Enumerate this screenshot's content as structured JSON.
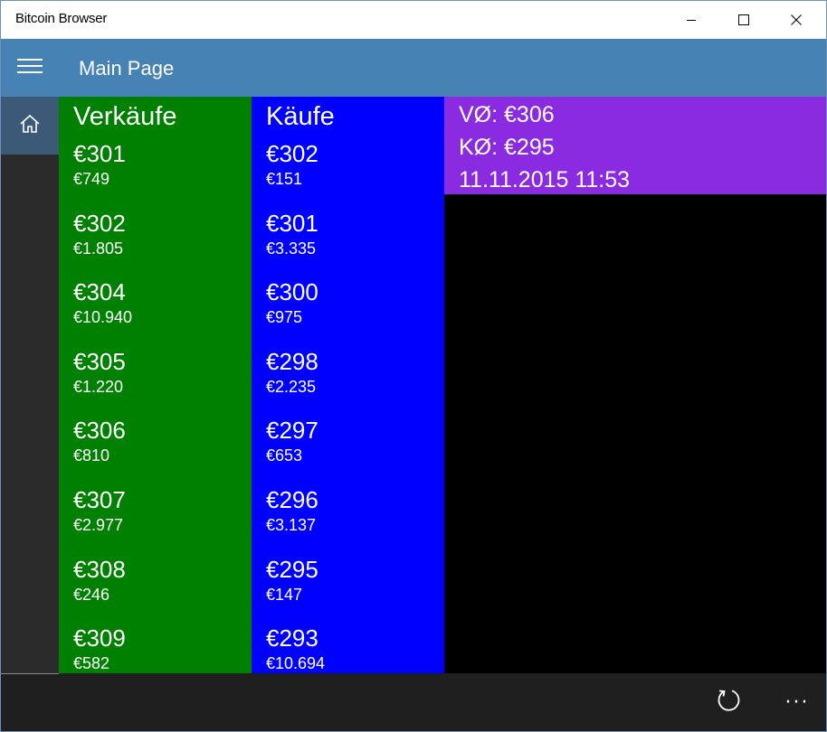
{
  "window": {
    "title": "Bitcoin Browser",
    "controls": {
      "minimize_icon": "minimize-icon",
      "maximize_icon": "maximize-icon",
      "close_icon": "close-icon"
    }
  },
  "appbar": {
    "title": "Main Page",
    "menu_icon": "hamburger-icon"
  },
  "nav": {
    "home_icon": "home-icon"
  },
  "sales": {
    "header": "Verkäufe",
    "items": [
      {
        "price": "€301",
        "amount": "€749"
      },
      {
        "price": "€302",
        "amount": "€1.805"
      },
      {
        "price": "€304",
        "amount": "€10.940"
      },
      {
        "price": "€305",
        "amount": "€1.220"
      },
      {
        "price": "€306",
        "amount": "€810"
      },
      {
        "price": "€307",
        "amount": "€2.977"
      },
      {
        "price": "€308",
        "amount": "€246"
      },
      {
        "price": "€309",
        "amount": "€582"
      }
    ]
  },
  "buys": {
    "header": "Käufe",
    "items": [
      {
        "price": "€302",
        "amount": "€151"
      },
      {
        "price": "€301",
        "amount": "€3.335"
      },
      {
        "price": "€300",
        "amount": "€975"
      },
      {
        "price": "€298",
        "amount": "€2.235"
      },
      {
        "price": "€297",
        "amount": "€653"
      },
      {
        "price": "€296",
        "amount": "€3.137"
      },
      {
        "price": "€295",
        "amount": "€147"
      },
      {
        "price": "€293",
        "amount": "€10.694"
      }
    ]
  },
  "summary": {
    "sales_avg": "VØ: €306",
    "buys_avg": "KØ: €295",
    "timestamp": "11.11.2015 11:53"
  },
  "bottombar": {
    "refresh_icon": "refresh-icon",
    "more_label": "···"
  },
  "colors": {
    "appbar": "#4682b4",
    "sales_bg": "#008000",
    "buys_bg": "#0000ff",
    "summary_bg": "#8a2be2",
    "home_selected": "#3c5a78"
  }
}
